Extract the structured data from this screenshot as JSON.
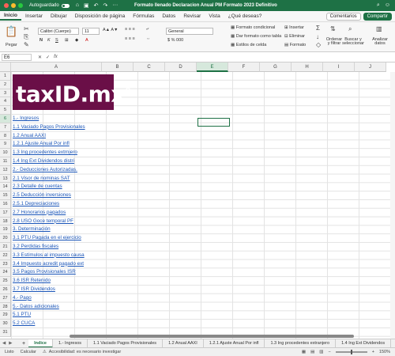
{
  "titlebar": {
    "autosave_label": "Autoguardado",
    "title": "Formato llenado Declaracion Anual PM Formato 2023 Definitivo",
    "colors": {
      "brand": "#1e7145"
    }
  },
  "menu": {
    "items": [
      "Inicio",
      "Insertar",
      "Dibujar",
      "Disposición de página",
      "Fórmulas",
      "Datos",
      "Revisar",
      "Vista",
      "¿Qué deseas?"
    ],
    "comments_label": "Comentarios",
    "share_label": "Compartir"
  },
  "ribbon": {
    "paste_label": "Pegar",
    "font_name": "Calibri (Cuerpo)",
    "font_size": "11",
    "number_format": "General",
    "cond_format": "Formato condicional",
    "table_format": "Dar formato como tabla",
    "cell_styles": "Estilos de celda",
    "insert": "Insertar",
    "delete": "Eliminar",
    "format": "Formato",
    "sort_filter": "Ordenar y filtrar",
    "find_select": "Buscar y seleccionar",
    "analyze": "Analizar datos"
  },
  "formula": {
    "namebox": "E6",
    "fx": "fx"
  },
  "columns": [
    "A",
    "B",
    "C",
    "D",
    "E",
    "F",
    "G",
    "H",
    "I",
    "J"
  ],
  "logo": {
    "text": "taxID.mx",
    "mark": "R"
  },
  "rows": [
    "1.- Ingresos",
    "1.1 Vaciado Pagos Provisionales",
    "1.2 Anual AAXI",
    "1.2.1 Ajuste Anual  Por infl",
    "1.3 Ing procedentes extrnjero",
    "1.4 Ing Ext Dividendos distri",
    "2.- Deducciones Autorizadas.",
    "2.1 Visor de nominas SAT",
    "2.3 Detalle de cuentas",
    "2.5 Deducción inversiones",
    "2.5.1 Depreciaciones",
    "2.7 Honorarios pagados",
    "2.8 USO Goce temporal PF",
    "3. Determinación",
    "3.1 PTU Pagada en el ejercicio",
    "3.2 Perdidas fiscales",
    "3.3 Estímulos al impuesto causa",
    "3.4 Impuesto acredit pagado ext",
    "3.5 Pagos Provisionales ISR",
    "3.6 ISR Retenido",
    "3.7 ISR Dividendos",
    "4.- Pago",
    "5.- Datos adicionales",
    "5.1 PTU",
    "5.2 CUCA"
  ],
  "row_numbers": [
    "1",
    "2",
    "3",
    "4",
    "5",
    "6",
    "7",
    "8",
    "9",
    "10",
    "11",
    "12",
    "13",
    "14",
    "15",
    "16",
    "17",
    "18",
    "19",
    "20",
    "21",
    "22",
    "23",
    "24",
    "25",
    "26",
    "27",
    "28",
    "29",
    "30",
    "31"
  ],
  "sheet_tabs": [
    "Indice",
    "1.- Ingresos",
    "1.1 Vaciado Pagos Provisionales",
    "1.2 Anual AAXI",
    "1.2.1 Ajuste Anual  Por infl",
    "1.3 Ing procedentes extranjero",
    "1.4 Ing Ext Dividendos"
  ],
  "status": {
    "ready": "Listo",
    "calc": "Calcular",
    "accessibility": "Accesibilidad: es necesario investigar",
    "zoom": "150%"
  }
}
